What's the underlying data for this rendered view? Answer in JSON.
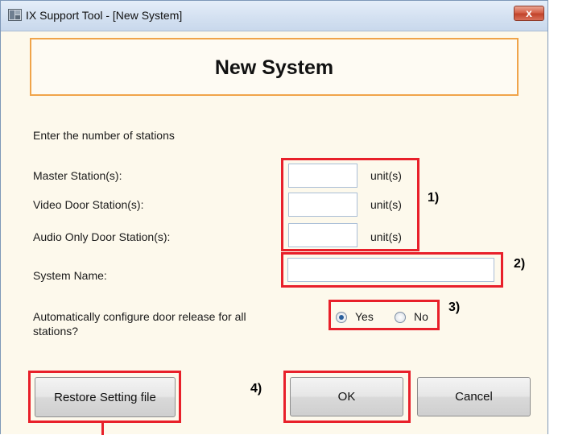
{
  "window": {
    "title": "IX Support Tool - [New System]",
    "close_label": "x"
  },
  "header": {
    "title": "New System"
  },
  "instruction": "Enter the number of stations",
  "stations": [
    {
      "label": "Master Station(s):",
      "value": "",
      "unit": "unit(s)"
    },
    {
      "label": "Video Door Station(s):",
      "value": "",
      "unit": "unit(s)"
    },
    {
      "label": "Audio Only Door Station(s):",
      "value": "",
      "unit": "unit(s)"
    }
  ],
  "system_name": {
    "label": "System Name:",
    "value": ""
  },
  "door_release": {
    "label_line1": "Automatically configure door release for all",
    "label_line2": "stations?",
    "options": [
      {
        "label": "Yes",
        "selected": true
      },
      {
        "label": "No",
        "selected": false
      }
    ]
  },
  "buttons": {
    "restore": "Restore Setting file",
    "ok": "OK",
    "cancel": "Cancel"
  },
  "annotations": {
    "marker1": "1)",
    "marker2": "2)",
    "marker3": "3)",
    "marker4": "4)",
    "highlight_color": "#e8202a"
  }
}
